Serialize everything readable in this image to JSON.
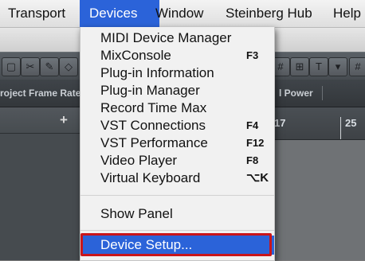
{
  "menubar": {
    "items": [
      {
        "label": "Transport"
      },
      {
        "label": "Devices"
      },
      {
        "label": "Window"
      },
      {
        "label": "Steinberg Hub"
      },
      {
        "label": "Help"
      }
    ]
  },
  "info_line": {
    "project_frame_rate": "roject Frame Rate",
    "power": "l Power"
  },
  "ruler": {
    "ticks": [
      "17",
      "25"
    ]
  },
  "track_list": {
    "add_glyph": "+"
  },
  "devices_menu": {
    "items": [
      {
        "label": "MIDI Device Manager",
        "shortcut": ""
      },
      {
        "label": "MixConsole",
        "shortcut": "F3"
      },
      {
        "label": "Plug-in Information",
        "shortcut": ""
      },
      {
        "label": "Plug-in Manager",
        "shortcut": ""
      },
      {
        "label": "Record Time Max",
        "shortcut": ""
      },
      {
        "label": "VST Connections",
        "shortcut": "F4"
      },
      {
        "label": "VST Performance",
        "shortcut": "F12"
      },
      {
        "label": "Video Player",
        "shortcut": "F8"
      },
      {
        "label": "Virtual Keyboard",
        "shortcut": "⌥K"
      },
      {
        "label": "Show Panel",
        "shortcut": ""
      },
      {
        "label": "Device Setup...",
        "shortcut": ""
      }
    ]
  },
  "colors": {
    "menu_selection": "#2b63d9",
    "highlight_outline": "#c9151b"
  }
}
